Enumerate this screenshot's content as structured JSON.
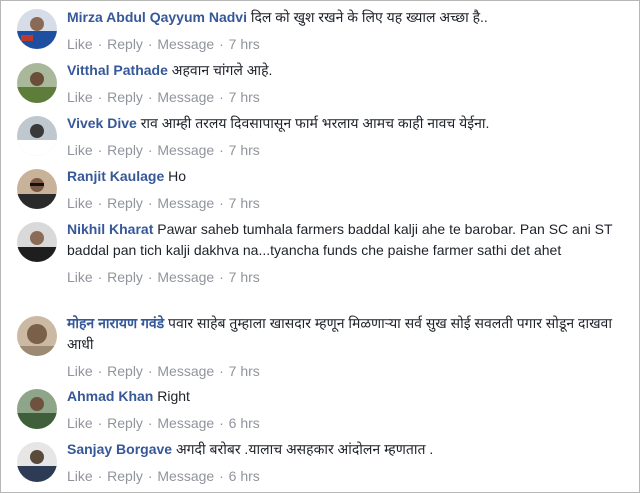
{
  "actions": {
    "like": "Like",
    "reply": "Reply",
    "message": "Message",
    "separator": "·"
  },
  "comments": [
    {
      "author": "Mirza Abdul Qayyum Nadvi",
      "text": "दिल को खुश रखने के लिए यह ख्याल अच्छा है..",
      "time": "7 hrs",
      "avatar_colors": [
        "#1f4fa0",
        "#c9d6e8"
      ]
    },
    {
      "author": "Vitthal Pathade",
      "text": "अहवान चांगले आहे.",
      "time": "7 hrs",
      "avatar_colors": [
        "#5e7d3a",
        "#a9b89a"
      ]
    },
    {
      "author": "Vivek Dive",
      "text": "राव आम्ही तरलय दिवसापासून फार्म भरलाय आमच काही नावच येईना.",
      "time": "7 hrs",
      "avatar_colors": [
        "#3a3a3a",
        "#bfc7cf"
      ]
    },
    {
      "author": "Ranjit Kaulage",
      "text": "Ho",
      "time": "7 hrs",
      "avatar_colors": [
        "#2a2a2a",
        "#c8b39a"
      ]
    },
    {
      "author": "Nikhil Kharat",
      "text": "Pawar saheb tumhala farmers baddal kalji ahe te barobar. Pan SC ani ST baddal pan tich kalji dakhva na...tyancha funds che paishe farmer sathi det ahet",
      "time": "7 hrs",
      "avatar_colors": [
        "#1e1e1e",
        "#d9d9d9"
      ]
    },
    {
      "author": "मोहन नारायण गवंडे",
      "text": "पवार साहेब तुम्हाला खासदार म्हणून मिळणाऱ्या सर्व सुख सोई सवलती पगार सोडून दाखवा आधी",
      "time": "7 hrs",
      "avatar_colors": [
        "#7a6048",
        "#cbb9a3"
      ]
    },
    {
      "author": "Ahmad Khan",
      "text": "Right",
      "time": "6 hrs",
      "avatar_colors": [
        "#3f5f3a",
        "#8fa58a"
      ]
    },
    {
      "author": "Sanjay Borgave",
      "text": "अगदी बरोबर .यालाच असहकार आंदोलन म्हणतात .",
      "time": "6 hrs",
      "avatar_colors": [
        "#2e3b55",
        "#e6e6e6"
      ]
    }
  ]
}
